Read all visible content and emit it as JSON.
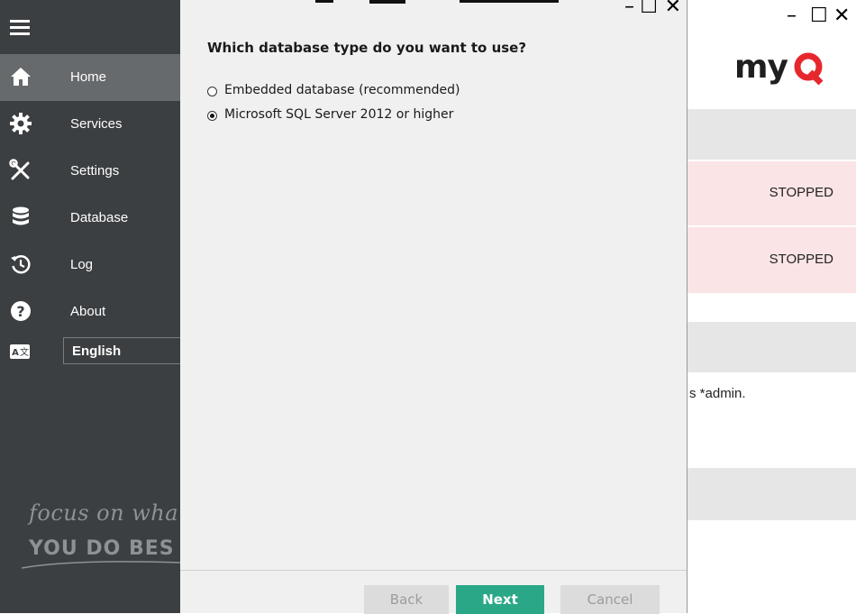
{
  "sidebar": {
    "items": [
      {
        "label": "Home",
        "icon": "home-icon"
      },
      {
        "label": "Services",
        "icon": "gear-icon"
      },
      {
        "label": "Settings",
        "icon": "tools-icon"
      },
      {
        "label": "Database",
        "icon": "database-icon"
      },
      {
        "label": "Log",
        "icon": "history-icon"
      },
      {
        "label": "About",
        "icon": "help-icon"
      }
    ],
    "language": {
      "icon": "translate-icon",
      "value": "English"
    },
    "tagline": {
      "line1": "focus on wha",
      "line2": "YOU DO BES"
    }
  },
  "dialog": {
    "question": "Which database type do you want to use?",
    "options": [
      {
        "label": "Embedded database (recommended)",
        "selected": false
      },
      {
        "label": "Microsoft SQL Server 2012 or higher",
        "selected": true
      }
    ],
    "buttons": {
      "back": "Back",
      "next": "Next",
      "cancel": "Cancel"
    },
    "controls": {
      "minimize": "–",
      "maximize": "☐",
      "close": "✕"
    }
  },
  "main_window": {
    "controls": {
      "minimize": "–",
      "maximize": "☐",
      "close": "✕"
    },
    "logo_text": "myQ",
    "statuses": [
      "STOPPED",
      "STOPPED"
    ],
    "note": "s *admin."
  },
  "colors": {
    "sidebar_bg": "#3c3f41",
    "active_bg": "#676a6c",
    "accent_green": "#2aa787",
    "logo_red": "#e6282e",
    "stopped_bg": "#fbe4e5"
  }
}
